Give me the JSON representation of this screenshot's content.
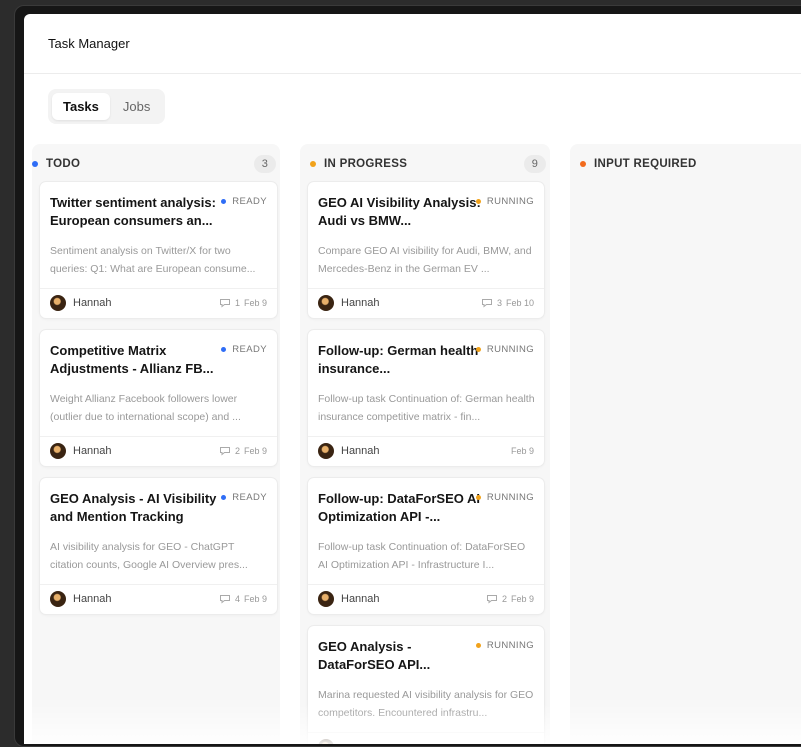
{
  "app": {
    "title": "Task Manager"
  },
  "tabs": [
    {
      "label": "Tasks",
      "active": true
    },
    {
      "label": "Jobs",
      "active": false
    }
  ],
  "colors": {
    "todo": "#2f6df6",
    "in_progress": "#f1a21b",
    "input_required": "#f26b1d",
    "ready": "#2f6df6",
    "running": "#f1a21b"
  },
  "columns": {
    "todo": {
      "label": "TODO",
      "count": "3",
      "cards": [
        {
          "title": "Twitter sentiment analysis: European consumers an...",
          "status": "READY",
          "description": "Sentiment analysis on Twitter/X for two queries: Q1: What are European consume...",
          "assignee": "Hannah",
          "comments": "1",
          "date": "Feb 9"
        },
        {
          "title": "Competitive Matrix Adjustments - Allianz FB...",
          "status": "READY",
          "description": "Weight Allianz Facebook followers lower (outlier due to international scope) and ...",
          "assignee": "Hannah",
          "comments": "2",
          "date": "Feb 9"
        },
        {
          "title": "GEO Analysis - AI Visibility and Mention Tracking",
          "status": "READY",
          "description": "AI visibility analysis for GEO - ChatGPT citation counts, Google AI Overview pres...",
          "assignee": "Hannah",
          "comments": "4",
          "date": "Feb 9"
        }
      ]
    },
    "in_progress": {
      "label": "IN PROGRESS",
      "count": "9",
      "cards": [
        {
          "title": "GEO AI Visibility Analysis: Audi vs BMW...",
          "status": "RUNNING",
          "description": "Compare GEO AI visibility for Audi, BMW, and Mercedes-Benz in the German EV ...",
          "assignee": "Hannah",
          "comments": "3",
          "date": "Feb 10"
        },
        {
          "title": "Follow-up: German health insurance...",
          "status": "RUNNING",
          "description": "Follow-up task Continuation of: German health insurance competitive matrix - fin...",
          "assignee": "Hannah",
          "comments": "",
          "date": "Feb 9"
        },
        {
          "title": "Follow-up: DataForSEO AI Optimization API -...",
          "status": "RUNNING",
          "description": "Follow-up task Continuation of: DataForSEO AI Optimization API - Infrastructure I...",
          "assignee": "Hannah",
          "comments": "2",
          "date": "Feb 9"
        },
        {
          "title": "GEO Analysis - DataForSEO API...",
          "status": "RUNNING",
          "description": "Marina requested AI visibility analysis for GEO competitors. Encountered infrastru...",
          "assignee": "",
          "comments": "",
          "date": ""
        }
      ]
    },
    "input_required": {
      "label": "INPUT REQUIRED",
      "count": ""
    }
  }
}
